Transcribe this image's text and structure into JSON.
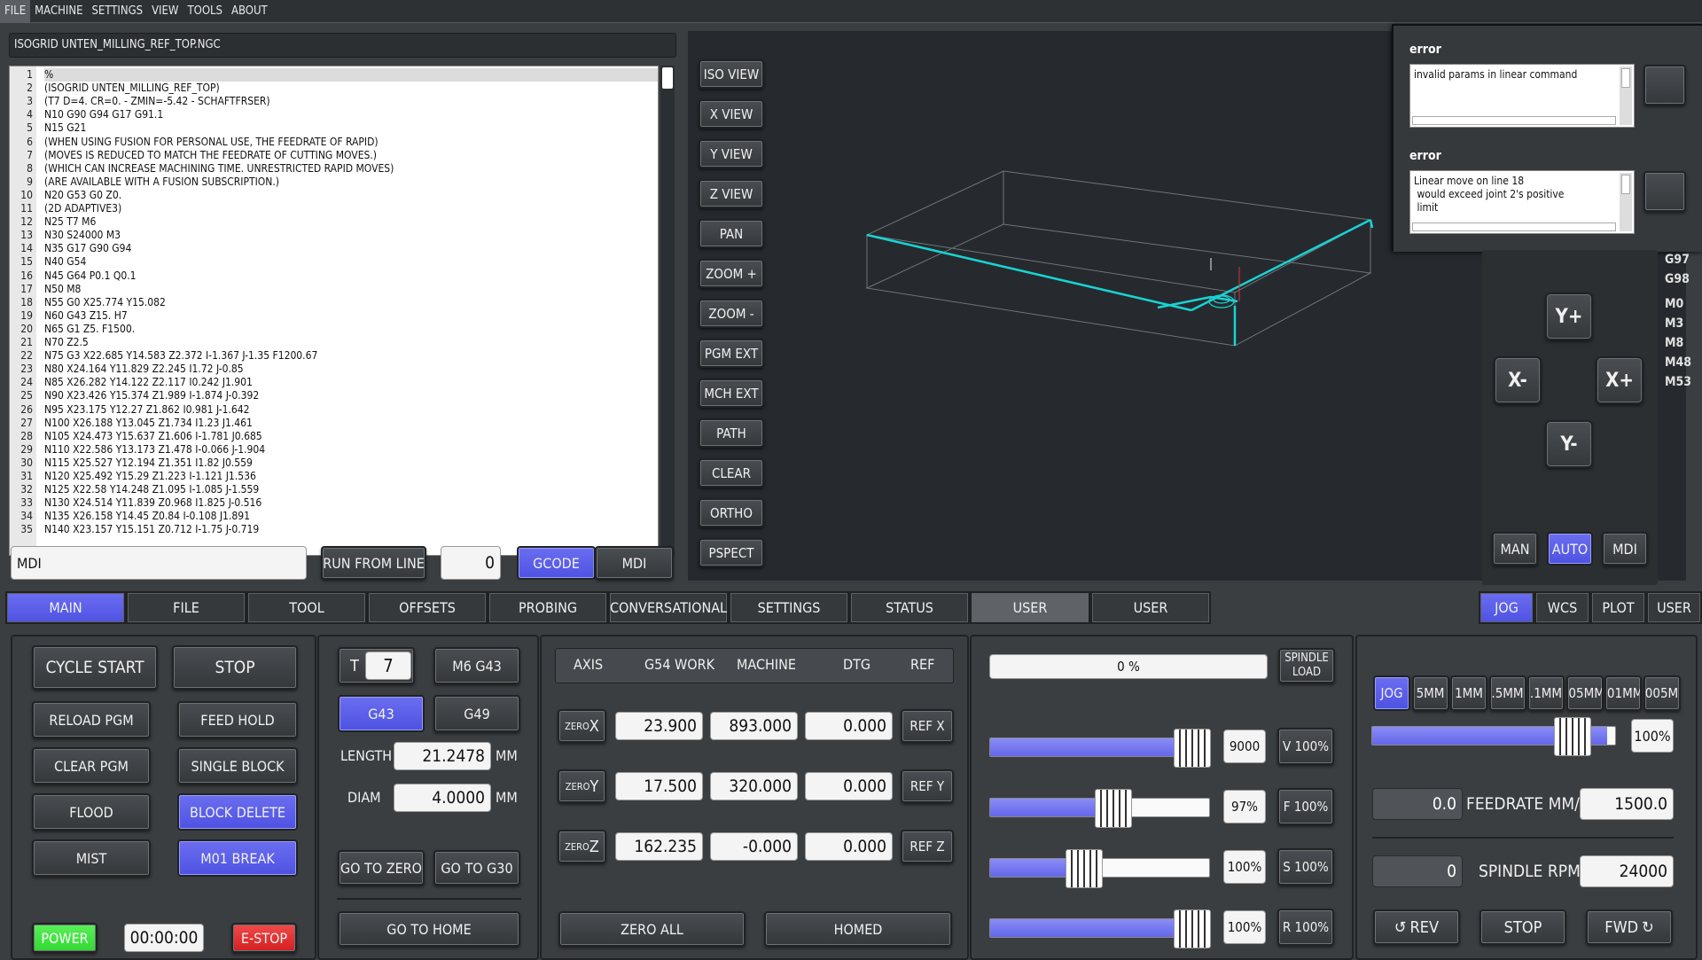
{
  "menubar": [
    "FILE",
    "MACHINE",
    "SETTINGS",
    "VIEW",
    "TOOLS",
    "ABOUT"
  ],
  "file_title": "ISOGRID UNTEN_MILLING_REF_TOP.NGC",
  "gcode_lines": [
    "%",
    "(ISOGRID UNTEN_MILLING_REF_TOP)",
    "(T7 D=4. CR=0. - ZMIN=-5.42 - SCHAFTFRSER)",
    "N10 G90 G94 G17 G91.1",
    "N15 G21",
    "(WHEN USING FUSION FOR PERSONAL USE, THE FEEDRATE OF RAPID)",
    "(MOVES IS REDUCED TO MATCH THE FEEDRATE OF CUTTING MOVES.)",
    "(WHICH CAN INCREASE MACHINING TIME. UNRESTRICTED RAPID MOVES)",
    "(ARE AVAILABLE WITH A FUSION SUBSCRIPTION.)",
    "N20 G53 G0 Z0.",
    "(2D ADAPTIVE3)",
    "N25 T7 M6",
    "N30 S24000 M3",
    "N35 G17 G90 G94",
    "N40 G54",
    "N45 G64 P0.1 Q0.1",
    "N50 M8",
    "N55 G0 X25.774 Y15.082",
    "N60 G43 Z15. H7",
    "N65 G1 Z5. F1500.",
    "N70 Z2.5",
    "N75 G3 X22.685 Y14.583 Z2.372 I-1.367 J-1.35 F1200.67",
    "N80 X24.164 Y11.829 Z2.245 I1.72 J-0.85",
    "N85 X26.282 Y14.122 Z2.117 I0.242 J1.901",
    "N90 X23.426 Y15.374 Z1.989 I-1.874 J-0.392",
    "N95 X23.175 Y12.27 Z1.862 I0.981 J-1.642",
    "N100 X26.188 Y13.045 Z1.734 I1.23 J1.461",
    "N105 X24.473 Y15.637 Z1.606 I-1.781 J0.685",
    "N110 X22.586 Y13.173 Z1.478 I-0.066 J-1.904",
    "N115 X25.527 Y12.194 Z1.351 I1.82 J0.559",
    "N120 X25.492 Y15.29 Z1.223 I-1.121 J1.536",
    "N125 X22.58 Y14.248 Z1.095 I-1.085 J-1.559",
    "N130 X24.514 Y11.839 Z0.968 I1.825 J-0.516",
    "N135 X26.158 Y14.45 Z0.84 I-0.108 J1.891",
    "N140 X23.157 Y15.151 Z0.712 I-1.75 J-0.719"
  ],
  "mdi_input": "MDI",
  "run_from_line": "RUN FROM LINE",
  "run_line_value": "0",
  "gcode_tab": "GCODE",
  "mdi_tab": "MDI",
  "view_buttons": [
    "ISO VIEW",
    "X VIEW",
    "Y VIEW",
    "Z VIEW",
    "PAN",
    "ZOOM +",
    "ZOOM -",
    "PGM EXT",
    "MCH EXT",
    "PATH",
    "CLEAR",
    "ORTHO",
    "PSPECT"
  ],
  "errors": [
    {
      "title": "error",
      "text": "invalid params in linear command"
    },
    {
      "title": "error",
      "text": "Linear move on line 18\n would exceed joint 2's positive\n limit"
    }
  ],
  "gcodes_active": [
    "G97",
    "G98",
    "M0",
    "M3",
    "M8",
    "M48",
    "M53"
  ],
  "jog_buttons": {
    "yplus": "Y+",
    "yminus": "Y-",
    "xplus": "X+",
    "xminus": "X-"
  },
  "mode_buttons": [
    "MAN",
    "AUTO",
    "MDI"
  ],
  "main_tabs": [
    "MAIN",
    "FILE",
    "TOOL",
    "OFFSETS",
    "PROBING",
    "CONVERSATIONAL",
    "SETTINGS",
    "STATUS",
    "USER",
    "USER"
  ],
  "right_tabs": [
    "JOG",
    "WCS",
    "PLOT",
    "USER"
  ],
  "control": {
    "cycle_start": "CYCLE START",
    "stop": "STOP",
    "reload": "RELOAD PGM",
    "feed_hold": "FEED HOLD",
    "clear_pgm": "CLEAR PGM",
    "single_block": "SINGLE BLOCK",
    "flood": "FLOOD",
    "block_delete": "BLOCK DELETE",
    "mist": "MIST",
    "m01": "M01 BREAK",
    "power": "POWER",
    "timer": "00:00:00",
    "estop": "E-STOP"
  },
  "tool": {
    "t_label": "T",
    "t_value": "7",
    "m6g43": "M6 G43",
    "g43": "G43",
    "g49": "G49",
    "length_label": "LENGTH",
    "length_value": "21.2478",
    "diam_label": "DIAM",
    "diam_value": "4.0000",
    "unit": "MM",
    "go_zero": "GO TO ZERO",
    "go_g30": "GO TO G30",
    "go_home": "GO TO HOME"
  },
  "dro": {
    "headers": [
      "AXIS",
      "G54 WORK",
      "MACHINE",
      "DTG",
      "REF"
    ],
    "rows": [
      {
        "zero": "ZERO",
        "axis": "X",
        "work": "23.900",
        "machine": "893.000",
        "dtg": "0.000",
        "ref": "REF X"
      },
      {
        "zero": "ZERO",
        "axis": "Y",
        "work": "17.500",
        "machine": "320.000",
        "dtg": "0.000",
        "ref": "REF Y"
      },
      {
        "zero": "ZERO",
        "axis": "Z",
        "work": "162.235",
        "machine": "-0.000",
        "dtg": "0.000",
        "ref": "REF Z"
      }
    ],
    "zero_all": "ZERO ALL",
    "homed": "HOMED"
  },
  "overrides": {
    "spindle_load": "0 %",
    "spindle_load_label": "SPINDLE LOAD",
    "rows": [
      {
        "value": "9000",
        "btn": "V 100%",
        "fraction": 0.84
      },
      {
        "value": "97%",
        "btn": "F 100%",
        "fraction": 0.48
      },
      {
        "value": "100%",
        "btn": "S 100%",
        "fraction": 0.35
      },
      {
        "value": "100%",
        "btn": "R 100%",
        "fraction": 0.84
      }
    ]
  },
  "jog": {
    "increments": [
      "JOG",
      "5MM",
      "1MM",
      ".5MM",
      ".1MM",
      ".05MM",
      ".01MM",
      "005M"
    ],
    "jog_rate": "100%",
    "jog_fraction": 0.96,
    "feedrate_actual": "0.0",
    "feedrate_label": "FEEDRATE MM/M",
    "feedrate_value": "1500.0",
    "spindle_actual": "0",
    "spindle_label": "SPINDLE RPM",
    "spindle_value": "24000",
    "rev": "REV",
    "stop": "STOP",
    "fwd": "FWD"
  },
  "colors": {
    "accent": "#5b5ee8",
    "toolpath": "#19d3d3",
    "estop": "#e02a2a",
    "power": "#3fe03f"
  }
}
